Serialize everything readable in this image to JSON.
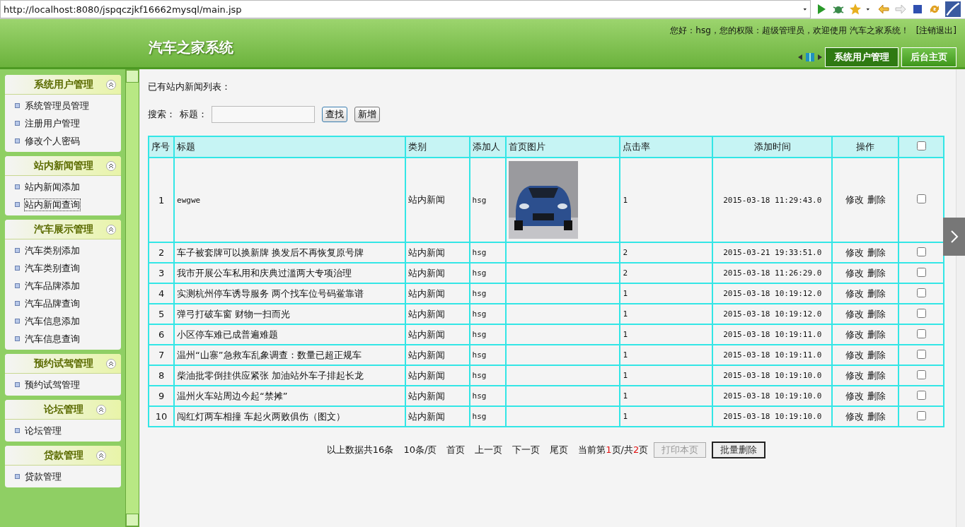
{
  "browser": {
    "url": "http://localhost:8080/jspqczjkf16662mysql/main.jsp"
  },
  "header": {
    "title": "汽车之家系统",
    "greeting": "您好：hsg，您的权限：超级管理员，欢迎使用 汽车之家系统！",
    "logout": "[注销退出]",
    "tabs": [
      {
        "label": "系统用户管理",
        "selected": true
      },
      {
        "label": "后台主页",
        "selected": false
      }
    ]
  },
  "sidebar": {
    "groups": [
      {
        "title": "系统用户管理",
        "expanded": true,
        "items": [
          {
            "label": "系统管理员管理",
            "selected": false
          },
          {
            "label": "注册用户管理",
            "selected": false
          },
          {
            "label": "修改个人密码",
            "selected": false
          }
        ]
      },
      {
        "title": "站内新闻管理",
        "expanded": true,
        "items": [
          {
            "label": "站内新闻添加",
            "selected": false
          },
          {
            "label": "站内新闻查询",
            "selected": true
          }
        ]
      },
      {
        "title": "汽车展示管理",
        "expanded": true,
        "items": [
          {
            "label": "汽车类别添加",
            "selected": false
          },
          {
            "label": "汽车类别查询",
            "selected": false
          },
          {
            "label": "汽车品牌添加",
            "selected": false
          },
          {
            "label": "汽车品牌查询",
            "selected": false
          },
          {
            "label": "汽车信息添加",
            "selected": false
          },
          {
            "label": "汽车信息查询",
            "selected": false
          }
        ]
      },
      {
        "title": "预约试驾管理",
        "expanded": true,
        "items": [
          {
            "label": "预约试驾管理",
            "selected": false
          }
        ]
      },
      {
        "title": "论坛管理",
        "expanded": true,
        "items": [
          {
            "label": "论坛管理",
            "selected": false
          }
        ]
      },
      {
        "title": "贷款管理",
        "expanded": true,
        "items": [
          {
            "label": "贷款管理",
            "selected": false
          }
        ]
      }
    ]
  },
  "content": {
    "heading": "已有站内新闻列表：",
    "search_label": "搜索：",
    "field_label": "标题：",
    "search_button": "查找",
    "add_button": "新增"
  },
  "table": {
    "columns": [
      "序号",
      "标题",
      "类别",
      "添加人",
      "首页图片",
      "点击率",
      "添加时间",
      "操作"
    ],
    "select_all": {
      "checked": false
    },
    "rows": [
      {
        "no": "1",
        "title": "ewgwe",
        "category": "站内新闻",
        "author": "hsg",
        "image": {
          "kind": "picture"
        },
        "clicks": "1",
        "time": "2015-03-18 11:29:43.0",
        "actions": [
          "修改",
          "删除"
        ],
        "checked": false
      },
      {
        "no": "2",
        "title": "车子被套牌可以换新牌 换发后不再恢复原号牌",
        "category": "站内新闻",
        "author": "hsg",
        "clicks": "2",
        "time": "2015-03-21 19:33:51.0",
        "actions": [
          "修改",
          "删除"
        ],
        "checked": false
      },
      {
        "no": "3",
        "title": "我市开展公车私用和庆典过滥两大专项治理",
        "category": "站内新闻",
        "author": "hsg",
        "clicks": "2",
        "time": "2015-03-18 11:26:29.0",
        "actions": [
          "修改",
          "删除"
        ],
        "checked": false
      },
      {
        "no": "4",
        "title": "实测杭州停车诱导服务 两个找车位号码鲎靠谱",
        "category": "站内新闻",
        "author": "hsg",
        "clicks": "1",
        "time": "2015-03-18 10:19:12.0",
        "actions": [
          "修改",
          "删除"
        ],
        "checked": false
      },
      {
        "no": "5",
        "title": "弹弓打破车窗 财物一扫而光",
        "category": "站内新闻",
        "author": "hsg",
        "clicks": "1",
        "time": "2015-03-18 10:19:12.0",
        "actions": [
          "修改",
          "删除"
        ],
        "checked": false
      },
      {
        "no": "6",
        "title": "小区停车难已成普遍难题",
        "category": "站内新闻",
        "author": "hsg",
        "clicks": "1",
        "time": "2015-03-18 10:19:11.0",
        "actions": [
          "修改",
          "删除"
        ],
        "checked": false
      },
      {
        "no": "7",
        "title": "温州“山寨”急救车乱象调查：数量已超正规车",
        "category": "站内新闻",
        "author": "hsg",
        "clicks": "1",
        "time": "2015-03-18 10:19:11.0",
        "actions": [
          "修改",
          "删除"
        ],
        "checked": false
      },
      {
        "no": "8",
        "title": "柴油批零倒挂供应紧张 加油站外车子排起长龙",
        "category": "站内新闻",
        "author": "hsg",
        "clicks": "1",
        "time": "2015-03-18 10:19:10.0",
        "actions": [
          "修改",
          "删除"
        ],
        "checked": false
      },
      {
        "no": "9",
        "title": "温州火车站周边今起“禁摊”",
        "category": "站内新闻",
        "author": "hsg",
        "clicks": "1",
        "time": "2015-03-18 10:19:10.0",
        "actions": [
          "修改",
          "删除"
        ],
        "checked": false
      },
      {
        "no": "10",
        "title": "闯红灯两车相撞 车起火两败俱伤（图文）",
        "category": "站内新闻",
        "author": "hsg",
        "clicks": "1",
        "time": "2015-03-18 10:19:10.0",
        "actions": [
          "修改",
          "删除"
        ],
        "checked": false
      }
    ]
  },
  "pagination": {
    "summary": "以上数据共16条",
    "per_page": "10条/页",
    "links": [
      "首页",
      "上一页",
      "下一页",
      "尾页"
    ],
    "status": {
      "prefix": "当前第",
      "current": "1",
      "middle": "页/共",
      "total": "2",
      "suffix": "页"
    },
    "buttons": [
      {
        "label": "打印本页",
        "disabled": true
      },
      {
        "label": "批量删除",
        "disabled": false
      }
    ]
  }
}
